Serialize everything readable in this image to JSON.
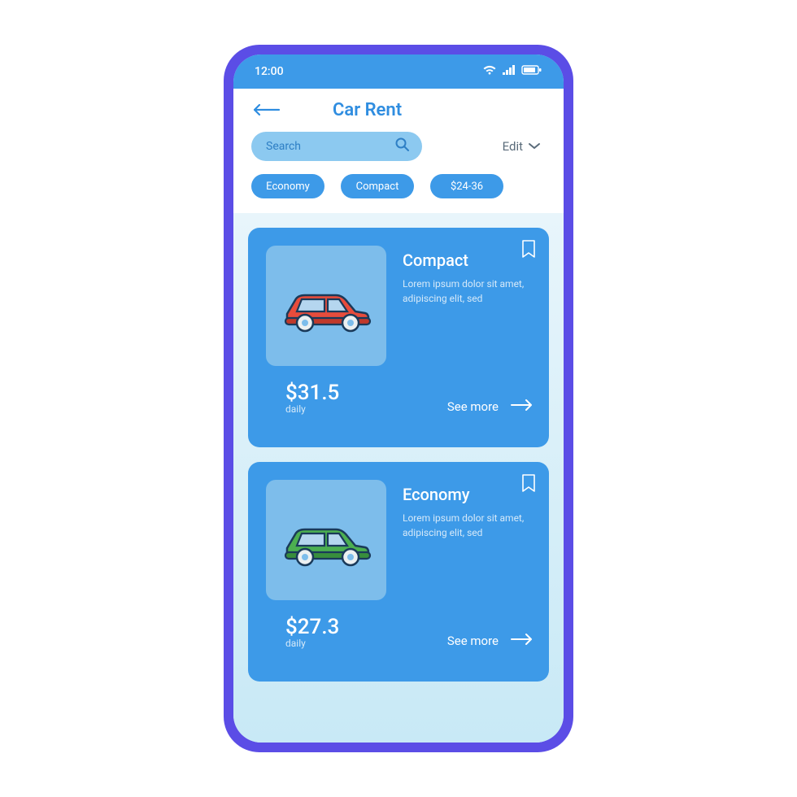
{
  "status_bar": {
    "time": "12:00"
  },
  "header": {
    "title": "Car Rent"
  },
  "search": {
    "placeholder": "Search"
  },
  "edit": {
    "label": "Edit"
  },
  "chips": [
    {
      "label": "Economy"
    },
    {
      "label": "Compact"
    },
    {
      "label": "$24-36"
    }
  ],
  "cards": [
    {
      "name": "Compact",
      "desc": "Lorem ipsum dolor sit amet, adipiscing elit, sed",
      "price": "$31.5",
      "period": "daily",
      "see_more": "See more",
      "car_color": "#e74c3c",
      "car_accent": "#c0392b"
    },
    {
      "name": "Economy",
      "desc": "Lorem ipsum dolor sit amet, adipiscing elit, sed",
      "price": "$27.3",
      "period": "daily",
      "see_more": "See more",
      "car_color": "#4caf50",
      "car_accent": "#388e3c"
    }
  ]
}
